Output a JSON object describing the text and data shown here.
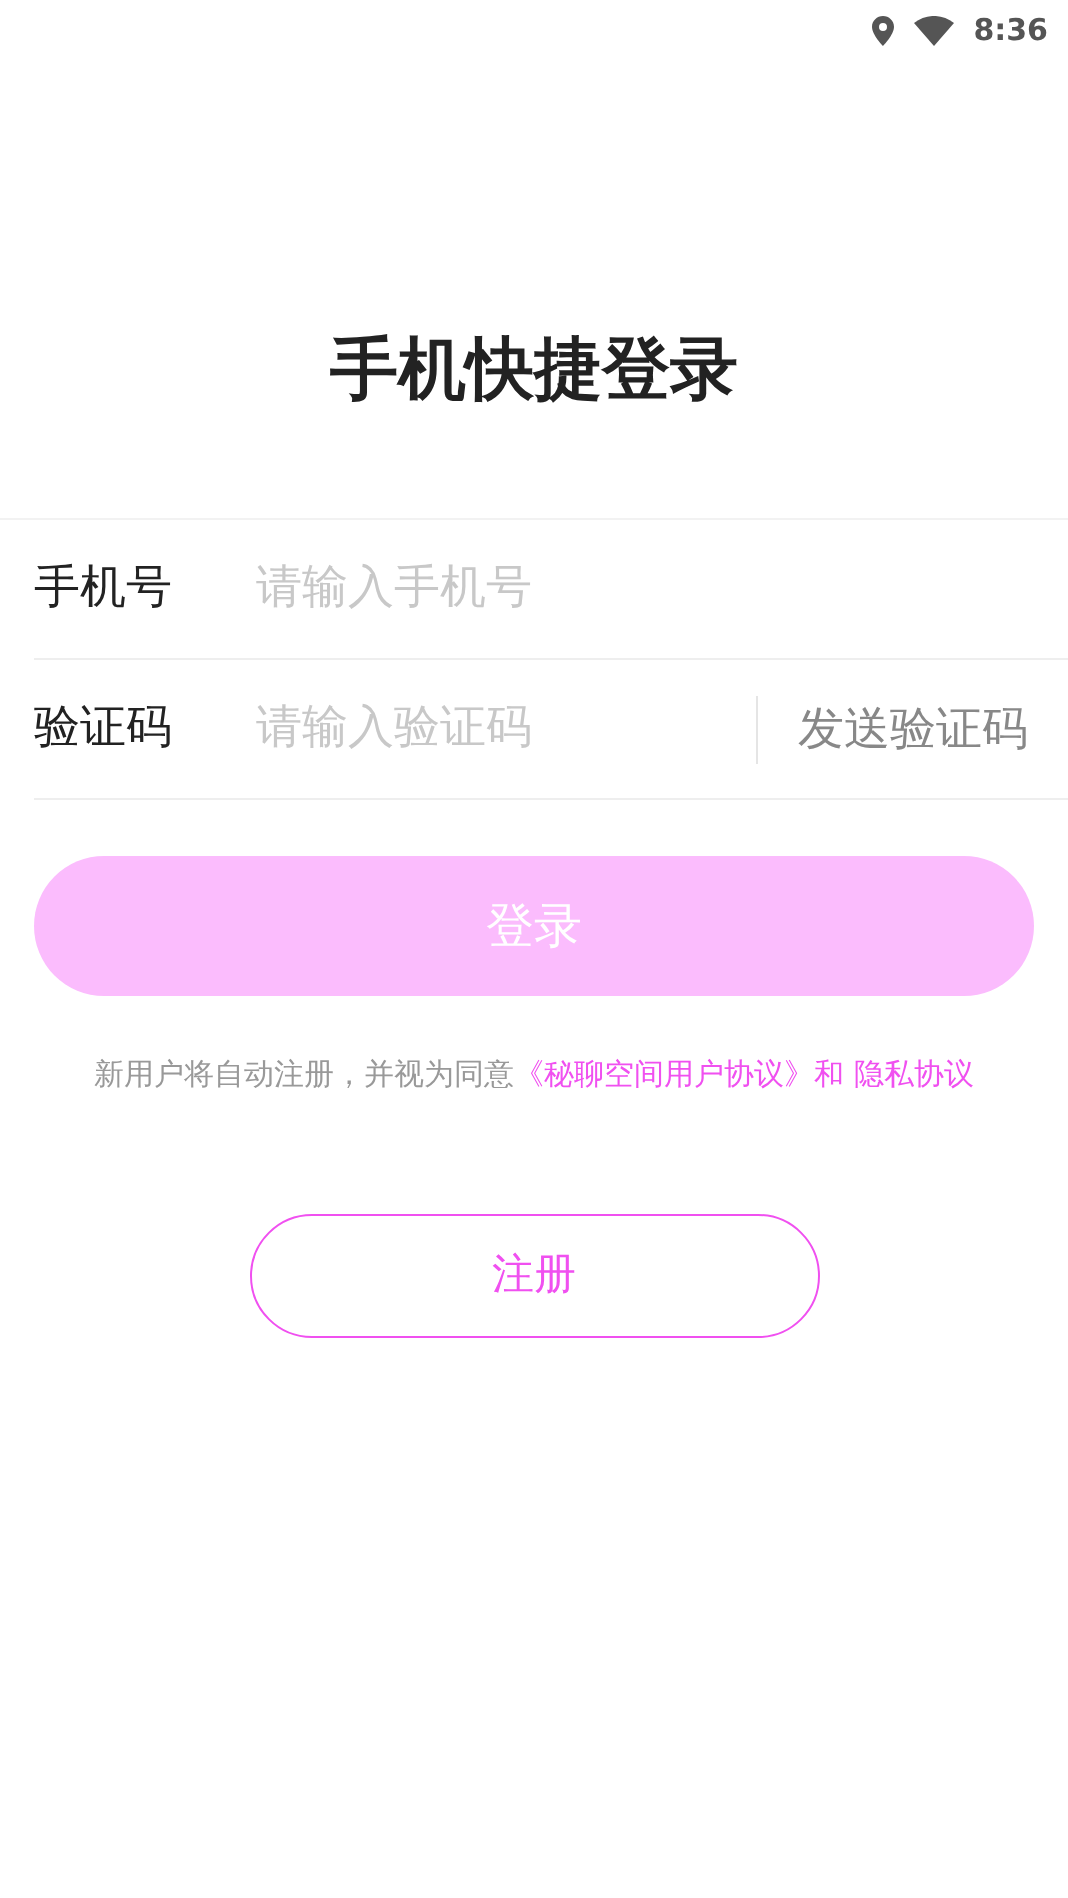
{
  "status_bar": {
    "time": "8:36"
  },
  "title": "手机快捷登录",
  "fields": [
    {
      "label": "手机号",
      "placeholder": "请输入手机号"
    },
    {
      "label": "验证码",
      "placeholder": "请输入验证码",
      "action": "发送验证码"
    }
  ],
  "login_button": {
    "label": "登录",
    "disabled": true
  },
  "agreement": [
    {
      "kind": "text",
      "text": "新用户将自动注册，并视为同意"
    },
    {
      "kind": "link",
      "text": "《秘聊空间用户协议》"
    },
    {
      "kind": "accent",
      "text": "和"
    },
    {
      "kind": "link",
      "text": "隐私协议"
    }
  ],
  "register_button": {
    "label": "注册"
  }
}
